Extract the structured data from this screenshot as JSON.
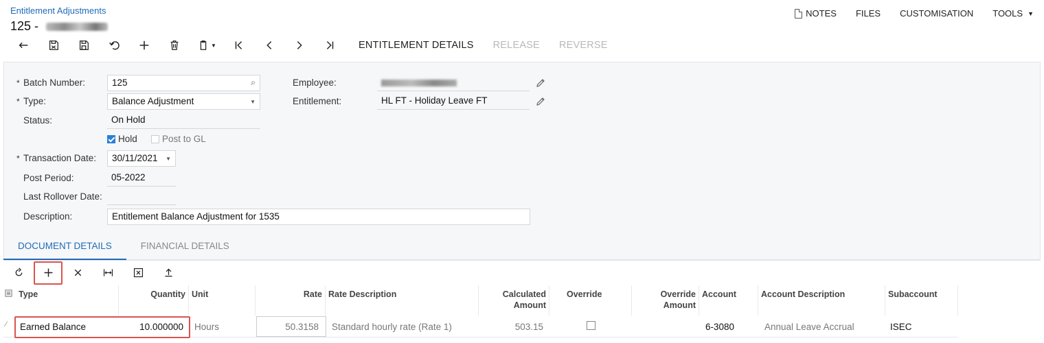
{
  "header": {
    "breadcrumb": "Entitlement Adjustments",
    "title": "125 - ",
    "menu": {
      "notes": "NOTES",
      "files": "FILES",
      "customisation": "CUSTOMISATION",
      "tools": "TOOLS"
    }
  },
  "toolbar": {
    "entitlement_details": "ENTITLEMENT DETAILS",
    "release": "RELEASE",
    "reverse": "REVERSE"
  },
  "form": {
    "batch_number_label": "Batch Number:",
    "batch_number_value": "125",
    "type_label": "Type:",
    "type_value": "Balance Adjustment",
    "status_label": "Status:",
    "status_value": "On Hold",
    "hold_label": "Hold",
    "hold_checked": true,
    "post_to_gl_label": "Post to GL",
    "post_to_gl_checked": false,
    "transaction_date_label": "Transaction Date:",
    "transaction_date_value": "30/11/2021",
    "post_period_label": "Post Period:",
    "post_period_value": "05-2022",
    "last_rollover_label": "Last Rollover Date:",
    "last_rollover_value": "",
    "description_label": "Description:",
    "description_value": "Entitlement  Balance Adjustment for 1535",
    "employee_label": "Employee:",
    "entitlement_label": "Entitlement:",
    "entitlement_value": "HL FT - Holiday Leave FT"
  },
  "tabs": [
    {
      "label": "DOCUMENT DETAILS",
      "active": true
    },
    {
      "label": "FINANCIAL DETAILS",
      "active": false
    }
  ],
  "grid": {
    "columns": {
      "type": "Type",
      "quantity": "Quantity",
      "unit": "Unit",
      "rate": "Rate",
      "rate_description": "Rate Description",
      "calculated_amount_1": "Calculated",
      "calculated_amount_2": "Amount",
      "override": "Override",
      "override_amount_1": "Override",
      "override_amount_2": "Amount",
      "account": "Account",
      "account_description": "Account Description",
      "subaccount": "Subaccount"
    },
    "rows": [
      {
        "type": "Earned Balance",
        "quantity": "10.000000",
        "unit": "Hours",
        "rate": "50.3158",
        "rate_description": "Standard hourly rate (Rate 1)",
        "calculated_amount": "503.15",
        "override": false,
        "override_amount": "",
        "account": "6-3080",
        "account_description": "Annual Leave Accrual",
        "subaccount": "ISEC"
      }
    ]
  },
  "colors": {
    "accent": "#1f6bb8",
    "highlight": "#d9534f",
    "checkbox": "#2a7fd4"
  }
}
